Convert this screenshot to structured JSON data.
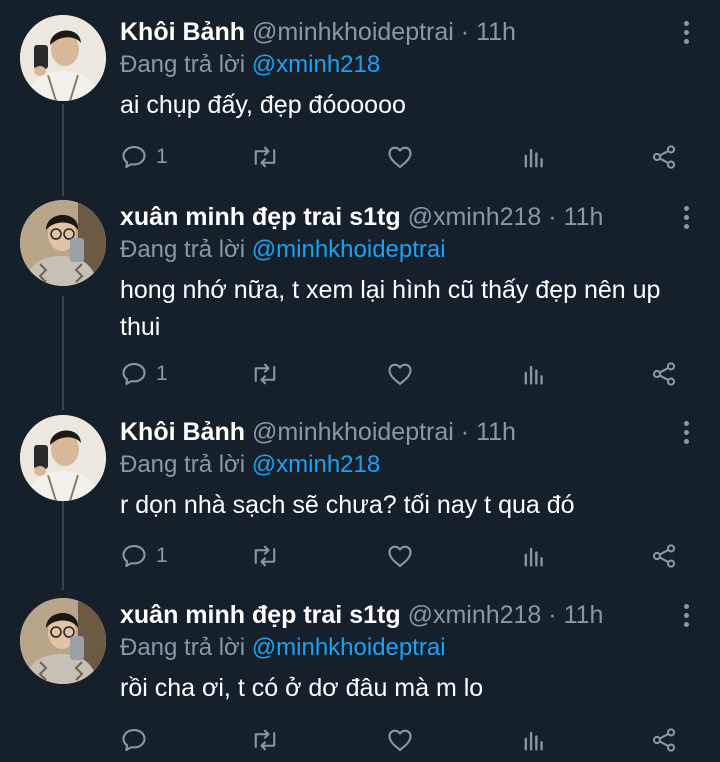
{
  "tweets": [
    {
      "name": "Khôi Bảnh",
      "handle": "@minhkhoideptrai",
      "time": "11h",
      "dot": "·",
      "reply_prefix": "Đang trả lời",
      "reply_to": "@xminh218",
      "text": "ai chụp đấy, đẹp đóooooo",
      "reply_count": "1"
    },
    {
      "name": "xuân minh đẹp trai s1tg",
      "handle": "@xminh218",
      "time": "11h",
      "dot": "·",
      "reply_prefix": "Đang trả lời",
      "reply_to": "@minhkhoideptrai",
      "text": "hong nhớ nữa, t xem lại hình cũ thấy đẹp nên up thui",
      "reply_count": "1"
    },
    {
      "name": "Khôi Bảnh",
      "handle": "@minhkhoideptrai",
      "time": "11h",
      "dot": "·",
      "reply_prefix": "Đang trả lời",
      "reply_to": "@xminh218",
      "text": "r dọn nhà sạch sẽ chưa? tối nay t qua đó",
      "reply_count": "1"
    },
    {
      "name": "xuân minh đẹp trai s1tg",
      "handle": "@xminh218",
      "time": "11h",
      "dot": "·",
      "reply_prefix": "Đang trả lời",
      "reply_to": "@minhkhoideptrai",
      "text": "rồi cha ơi, t có ở dơ đâu mà m lo",
      "reply_count": ""
    }
  ],
  "colors": {
    "background": "#15202b",
    "secondary_text": "#8899a6",
    "mention": "#1da1f2",
    "thread_line": "#38444d"
  },
  "icons": [
    "reply-icon",
    "retweet-icon",
    "like-icon",
    "analytics-icon",
    "share-icon",
    "more-options-icon"
  ]
}
